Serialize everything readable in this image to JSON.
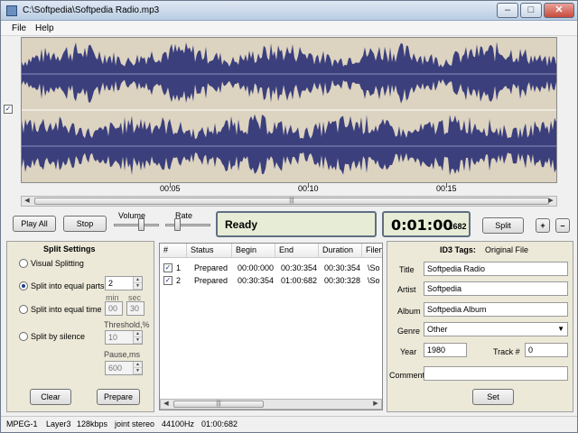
{
  "window": {
    "title": "C:\\Softpedia\\Softpedia Radio.mp3",
    "controls": [
      "–",
      "□",
      "✕"
    ]
  },
  "menu": [
    "File",
    "Help"
  ],
  "timeline": {
    "marks": [
      "00:05",
      "00:10",
      "00:15"
    ]
  },
  "transport": {
    "play_all": "Play All",
    "stop": "Stop",
    "volume_label": "Volume",
    "rate_label": "Rate",
    "volume_level": 0.6,
    "rate_level": 0.25,
    "status": "Ready",
    "time_main": "0:01:00",
    "time_ms": ".682",
    "split": "Split",
    "plus": "+",
    "minus": "–"
  },
  "split_settings": {
    "title": "Split Settings",
    "options": [
      "Visual Splitting",
      "Split into equal parts",
      "Split into equal time",
      "Split by silence"
    ],
    "selected": 1,
    "parts_value": "2",
    "min_label": "min",
    "sec_label": "sec",
    "min_value": "00",
    "sec_value": "30",
    "threshold_label": "Threshold,%",
    "threshold_value": "10",
    "pause_label": "Pause,ms",
    "pause_value": "600",
    "clear": "Clear",
    "prepare": "Prepare"
  },
  "table": {
    "headers": [
      "#",
      "Status",
      "Begin",
      "End",
      "Duration",
      "Filen"
    ],
    "rows": [
      {
        "num": "1",
        "status": "Prepared",
        "begin": "00:00:000",
        "end": "00:30:354",
        "duration": "00:30:354",
        "file": "\\So"
      },
      {
        "num": "2",
        "status": "Prepared",
        "begin": "00:30:354",
        "end": "01:00:682",
        "duration": "00:30:328",
        "file": "\\So"
      }
    ]
  },
  "id3": {
    "title": "ID3 Tags:",
    "source": "Original File",
    "title_label": "Title",
    "title_value": "Softpedia Radio",
    "artist_label": "Artist",
    "artist_value": "Softpedia",
    "album_label": "Album",
    "album_value": "Softpedia Album",
    "genre_label": "Genre",
    "genre_value": "Other",
    "year_label": "Year",
    "year_value": "1980",
    "track_label": "Track #",
    "track_value": "0",
    "comment_label": "Comment",
    "comment_value": "",
    "set": "Set"
  },
  "statusbar": [
    "MPEG-1",
    "Layer3",
    "128kbps",
    "joint stereo",
    "44100Hz",
    "01:00:682"
  ],
  "colors": {
    "wave_fill": "#3b3f7c",
    "wave_bg": "#dcd3c0",
    "accent": "#1c3f8a"
  }
}
